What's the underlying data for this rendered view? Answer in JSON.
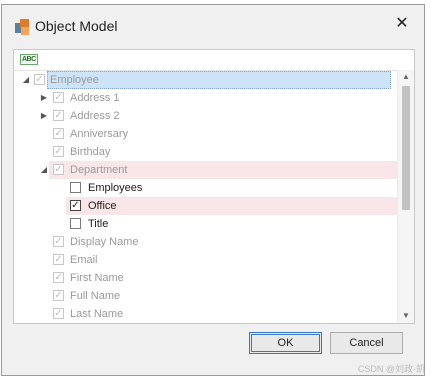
{
  "window": {
    "title": "Object Model",
    "close_glyph": "✕"
  },
  "toolbar": {
    "abc_label": "ABC"
  },
  "tree": [
    {
      "label": "Employee",
      "level": 0,
      "expander": "◢",
      "state": "disabled",
      "highlight": "blue"
    },
    {
      "label": "Address 1",
      "level": 1,
      "expander": "▶",
      "state": "disabled"
    },
    {
      "label": "Address 2",
      "level": 1,
      "expander": "▶",
      "state": "disabled"
    },
    {
      "label": "Anniversary",
      "level": 1,
      "expander": "",
      "state": "disabled"
    },
    {
      "label": "Birthday",
      "level": 1,
      "expander": "",
      "state": "disabled"
    },
    {
      "label": "Department",
      "level": 1,
      "expander": "◢",
      "state": "disabled",
      "highlight": "pink"
    },
    {
      "label": "Employees",
      "level": 2,
      "expander": "",
      "state": "unchecked"
    },
    {
      "label": "Office",
      "level": 2,
      "expander": "",
      "state": "checked",
      "highlight": "pink"
    },
    {
      "label": "Title",
      "level": 2,
      "expander": "",
      "state": "unchecked"
    },
    {
      "label": "Display Name",
      "level": 1,
      "expander": "",
      "state": "disabled"
    },
    {
      "label": "Email",
      "level": 1,
      "expander": "",
      "state": "disabled"
    },
    {
      "label": "First Name",
      "level": 1,
      "expander": "",
      "state": "disabled"
    },
    {
      "label": "Full Name",
      "level": 1,
      "expander": "",
      "state": "disabled"
    },
    {
      "label": "Last Name",
      "level": 1,
      "expander": "",
      "state": "disabled"
    }
  ],
  "buttons": {
    "ok": "OK",
    "cancel": "Cancel"
  },
  "watermark": "CSDN @刘政·凯",
  "colors": {
    "selection": "#cde3f7",
    "parent_highlight": "#f9e6e8",
    "accent": "#3a78c5"
  }
}
